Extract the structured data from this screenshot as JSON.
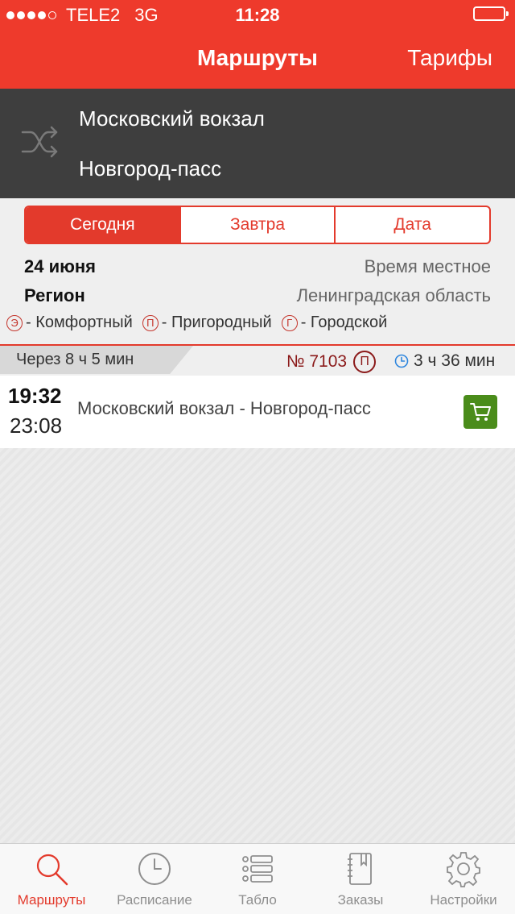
{
  "status": {
    "carrier": "TELE2",
    "network": "3G",
    "time": "11:28"
  },
  "nav": {
    "title": "Маршруты",
    "right_button": "Тарифы"
  },
  "route": {
    "from": "Московский вокзал",
    "to": "Новгород-пасс"
  },
  "segments": [
    "Сегодня",
    "Завтра",
    "Дата"
  ],
  "info": {
    "date": "24 июня",
    "time_note": "Время местное",
    "region_label": "Регион",
    "region": "Ленинградская область"
  },
  "legend": [
    {
      "symbol": "Э",
      "label": "- Комфортный"
    },
    {
      "symbol": "П",
      "label": "- Пригородный"
    },
    {
      "symbol": "Г",
      "label": "- Городской"
    }
  ],
  "trip": {
    "through": "Через 8 ч 5 мин",
    "train_no": "№ 7103",
    "train_type": "П",
    "duration": "3 ч 36 мин",
    "departure": "19:32",
    "arrival": "23:08",
    "route": "Московский вокзал - Новгород-пасс"
  },
  "tabs": [
    {
      "label": "Маршруты",
      "icon": "search-icon"
    },
    {
      "label": "Расписание",
      "icon": "clock-icon"
    },
    {
      "label": "Табло",
      "icon": "list-icon"
    },
    {
      "label": "Заказы",
      "icon": "notebook-icon"
    },
    {
      "label": "Настройки",
      "icon": "gear-icon"
    }
  ],
  "colors": {
    "accent": "#ee3a2c",
    "route_bg": "#3e3e3e",
    "cart": "#4a8c1a"
  }
}
